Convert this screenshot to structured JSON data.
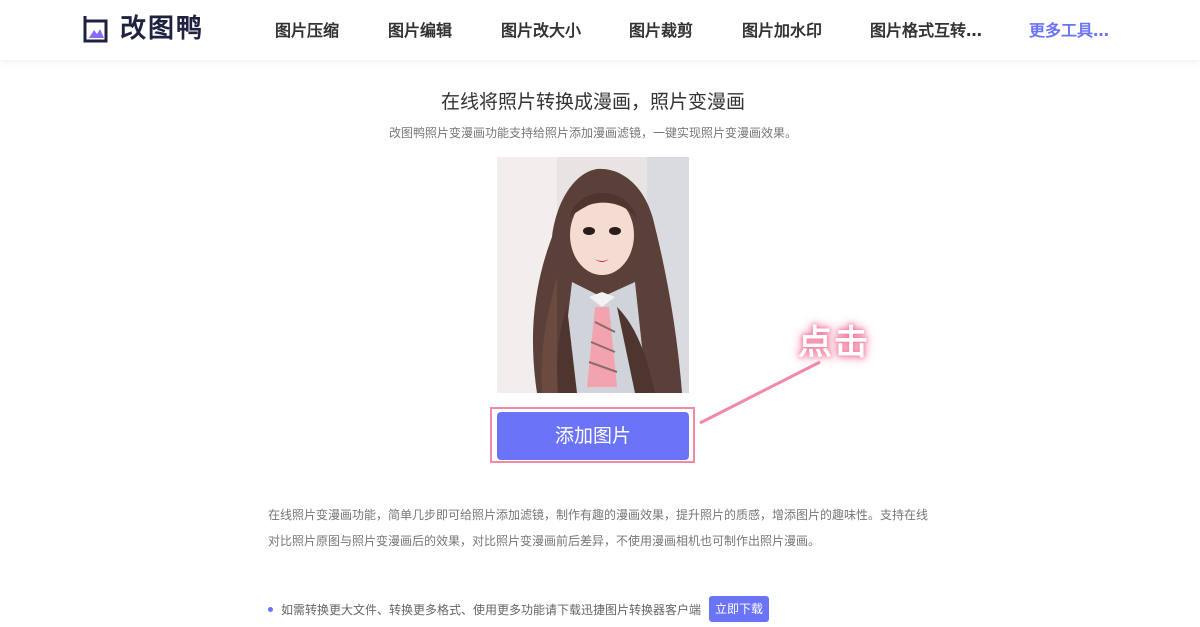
{
  "header": {
    "logo_text": "改图鸭",
    "nav": [
      {
        "label": "图片压缩"
      },
      {
        "label": "图片编辑"
      },
      {
        "label": "图片改大小"
      },
      {
        "label": "图片裁剪"
      },
      {
        "label": "图片加水印"
      },
      {
        "label": "图片格式互转…"
      },
      {
        "label": "更多工具…"
      }
    ]
  },
  "main": {
    "title": "在线将照片转换成漫画，照片变漫画",
    "subtitle": "改图鸭照片变漫画功能支持给照片添加漫画滤镜，一键实现照片变漫画效果。",
    "add_button_label": "添加图片",
    "click_hint": "点击",
    "description": "在线照片变漫画功能，简单几步即可给照片添加滤镜，制作有趣的漫画效果，提升照片的质感，增添图片的趣味性。支持在线对比照片原图与照片变漫画后的效果，对比照片变漫画前后差异，不使用漫画相机也可制作出照片漫画。",
    "note": "如需转换更大文件、转换更多格式、使用更多功能请下载迅捷图片转换器客户端",
    "download_label": "立即下载"
  },
  "colors": {
    "accent": "#6b74f7",
    "highlight": "#f28aa5",
    "logo": "#1f2140"
  }
}
